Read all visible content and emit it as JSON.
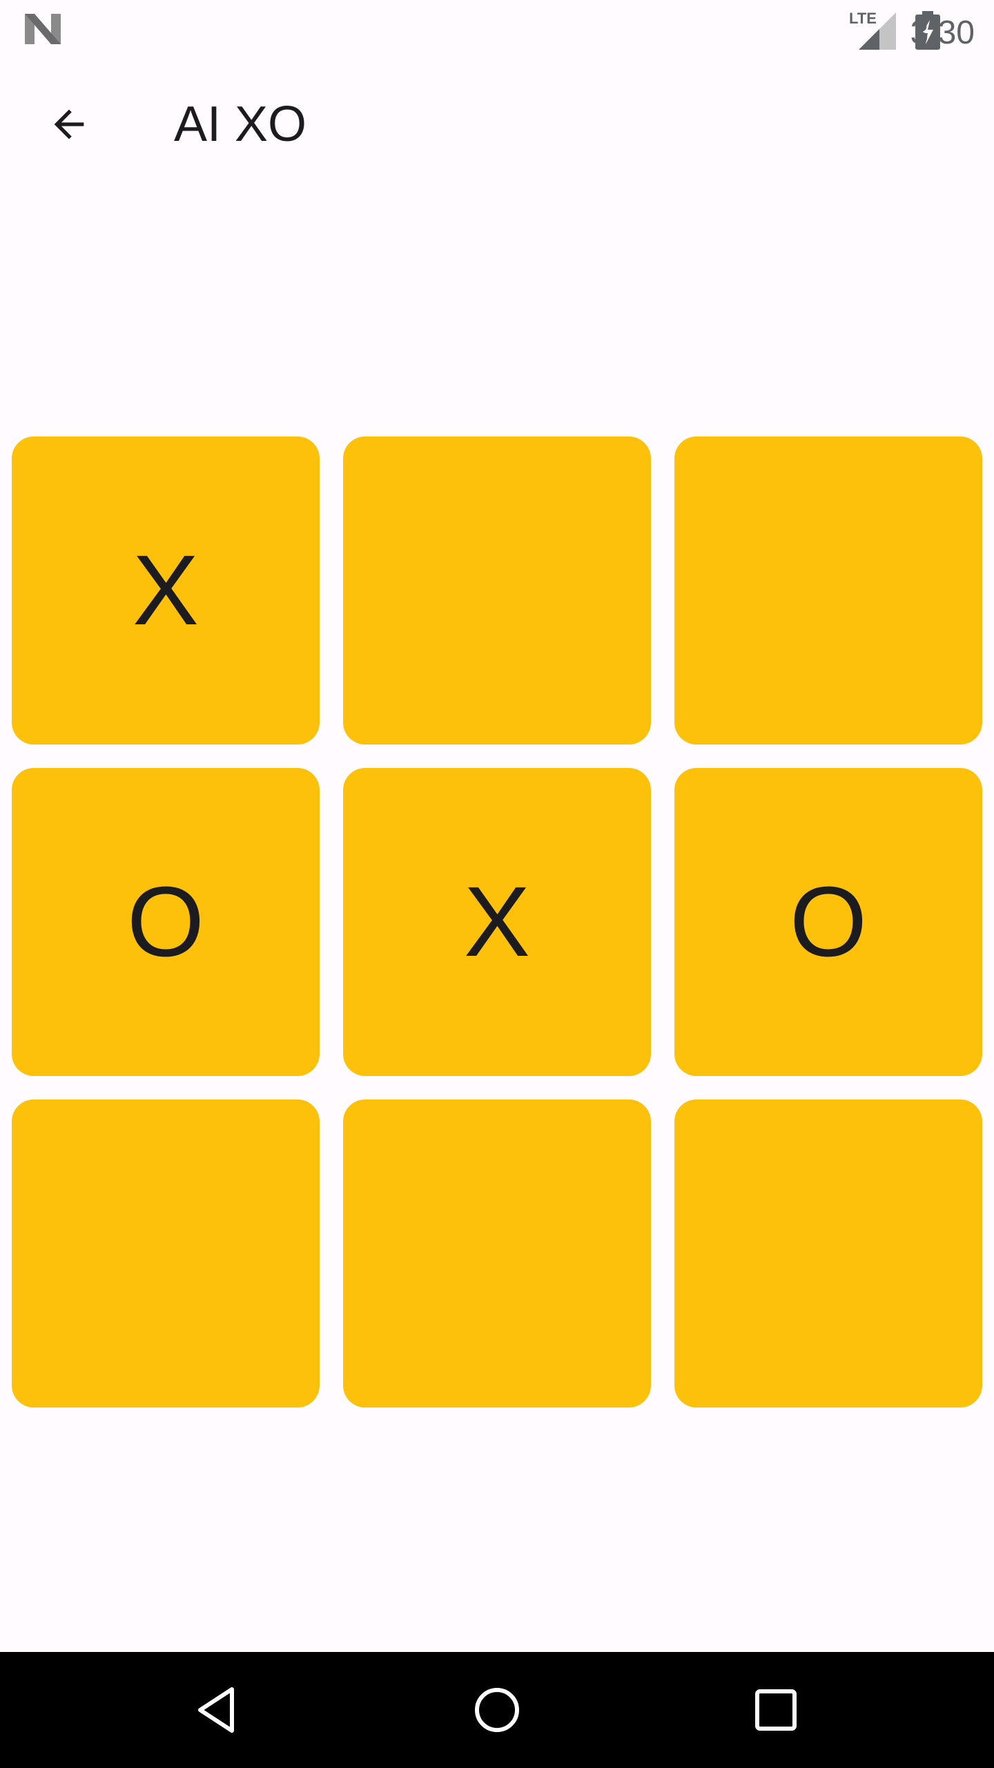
{
  "status_bar": {
    "clock": "3:30",
    "network": "LTE",
    "icons": [
      "android-n-icon",
      "lte-signal-icon",
      "battery-charging-icon"
    ]
  },
  "app_bar": {
    "title": "AI XO",
    "back_icon": "arrow-back-icon"
  },
  "board": {
    "cell_color": "#fdc10b",
    "cells": [
      "X",
      "",
      "",
      "O",
      "X",
      "O",
      "",
      "",
      ""
    ]
  },
  "nav_bar": {
    "icons": [
      "back-triangle-icon",
      "home-circle-icon",
      "recents-square-icon"
    ]
  },
  "colors": {
    "background": "#fffbfe",
    "text": "#1c1b1f",
    "cell": "#fdc10b",
    "nav_bar": "#000000"
  }
}
